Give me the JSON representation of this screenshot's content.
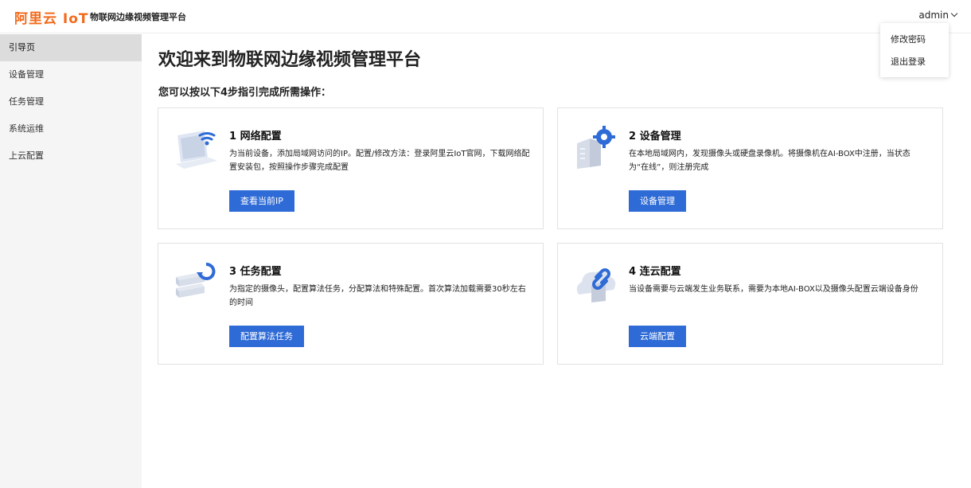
{
  "header": {
    "logo": "阿里云 IoT",
    "platform_title": "物联网边缘视频管理平台",
    "user": "admin"
  },
  "dropdown": {
    "items": [
      "修改密码",
      "退出登录"
    ]
  },
  "sidebar": {
    "items": [
      {
        "label": "引导页",
        "active": true
      },
      {
        "label": "设备管理"
      },
      {
        "label": "任务管理"
      },
      {
        "label": "系统运维"
      },
      {
        "label": "上云配置"
      }
    ]
  },
  "main": {
    "title": "欢迎来到物联网边缘视频管理平台",
    "subtitle": "您可以按以下4步指引完成所需操作：",
    "cards": [
      {
        "title": "1 网络配置",
        "desc": "为当前设备，添加局域网访问的IP。配置/修改方法：登录阿里云IoT官网，下载网络配置安装包，按照操作步骤完成配置",
        "button": "查看当前IP",
        "icon": "wifi-laptop-icon"
      },
      {
        "title": "2 设备管理",
        "desc": "在本地局域网内，发现摄像头或硬盘录像机。将摄像机在AI-BOX中注册，当状态为“在线”，则注册完成",
        "button": "设备管理",
        "icon": "device-gear-icon"
      },
      {
        "title": "3 任务配置",
        "desc": "为指定的摄像头，配置算法任务，分配算法和特殊配置。首次算法加载需要30秒左右的时间",
        "button": "配置算法任务",
        "icon": "task-sync-icon"
      },
      {
        "title": "4 连云配置",
        "desc": "当设备需要与云端发生业务联系，需要为本地AI-BOX以及摄像头配置云端设备身份",
        "button": "云端配置",
        "icon": "cloud-link-icon"
      }
    ]
  }
}
